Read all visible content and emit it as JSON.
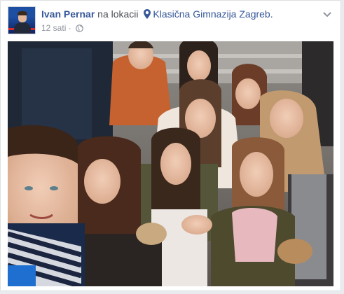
{
  "post": {
    "author": "Ivan Pernar",
    "location_prefix": "na lokacii",
    "location": "Klasična Gimnazija Zagreb.",
    "timestamp": "12 sati",
    "separator": "·",
    "audience_icon": "globe-icon",
    "menu_icon": "chevron-down-icon",
    "location_icon": "map-pin-icon"
  },
  "photo": {
    "subject": "group-selfie"
  },
  "colors": {
    "link": "#365899",
    "meta": "#90949c",
    "card_bg": "#ffffff",
    "page_bg": "#e9ebee"
  }
}
